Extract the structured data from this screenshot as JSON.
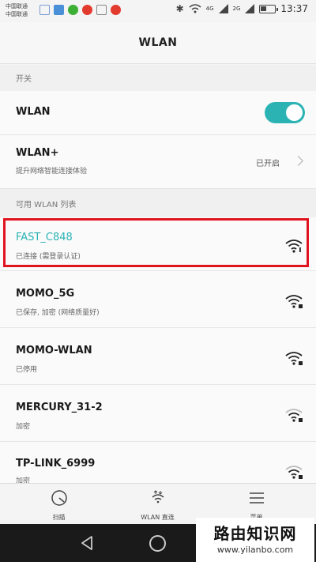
{
  "status_bar": {
    "carrier_1": "中国联通",
    "carrier_2": "中国联通",
    "network_1": "4G",
    "network_2": "2G",
    "time": "13:37",
    "battery_level": 0.45,
    "notification_icons": [
      "calendar-icon",
      "photo-icon",
      "wechat-icon",
      "weibo-icon",
      "gallery-icon",
      "weibo-icon"
    ]
  },
  "header": {
    "title": "WLAN"
  },
  "sections": {
    "switch_header": "开关",
    "list_header": "可用 WLAN 列表"
  },
  "wlan_row": {
    "label": "WLAN",
    "enabled": true
  },
  "wlan_plus_row": {
    "label": "WLAN+",
    "subtitle": "提升网络智能连接体验",
    "status": "已开启"
  },
  "networks": [
    {
      "ssid": "FAST_C848",
      "status": "已连接 (需登录认证)",
      "connected": true,
      "signal": 3
    },
    {
      "ssid": "MOMO_5G",
      "status": "已保存, 加密 (网络质量好)",
      "connected": false,
      "signal": 3
    },
    {
      "ssid": "MOMO-WLAN",
      "status": "已停用",
      "connected": false,
      "signal": 3
    },
    {
      "ssid": "MERCURY_31-2",
      "status": "加密",
      "connected": false,
      "signal": 2
    },
    {
      "ssid": "TP-LINK_6999",
      "status": "加密",
      "connected": false,
      "signal": 2
    }
  ],
  "tabs": [
    {
      "label": "扫描",
      "icon": "scan-icon"
    },
    {
      "label": "WLAN 直连",
      "icon": "wlan-direct-icon"
    },
    {
      "label": "菜单",
      "icon": "menu-icon"
    }
  ],
  "watermark": {
    "title": "路由知识网",
    "url": "www.yilanbo.com"
  },
  "colors": {
    "accent": "#2bb3b4",
    "highlight": "#e0141e"
  }
}
